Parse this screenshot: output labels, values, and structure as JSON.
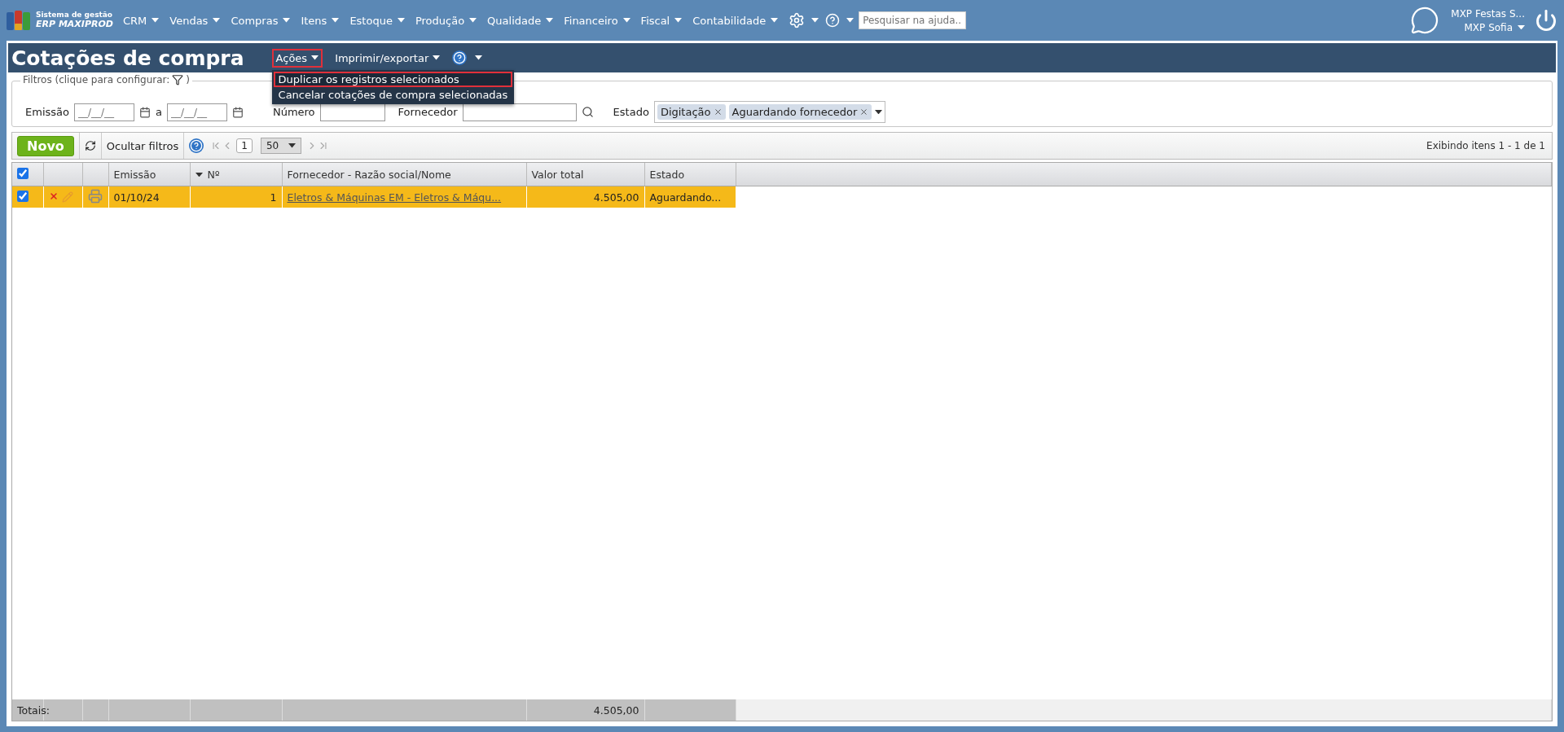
{
  "brand": {
    "line1": "Sistema de gestão",
    "line2": "ERP MAXIPROD"
  },
  "menu": [
    {
      "label": "CRM"
    },
    {
      "label": "Vendas"
    },
    {
      "label": "Compras"
    },
    {
      "label": "Itens"
    },
    {
      "label": "Estoque"
    },
    {
      "label": "Produção"
    },
    {
      "label": "Qualidade"
    },
    {
      "label": "Financeiro"
    },
    {
      "label": "Fiscal"
    },
    {
      "label": "Contabilidade"
    }
  ],
  "help_search": {
    "placeholder": "Pesquisar na ajuda..."
  },
  "user": {
    "company": "MXP Festas S...",
    "name": "MXP Sofia"
  },
  "page": {
    "title": "Cotações de compra"
  },
  "actions_menu": {
    "label": "Ações",
    "expanded": true,
    "items": [
      {
        "label": "Duplicar os registros selecionados",
        "selected": true
      },
      {
        "label": "Cancelar cotações de compra selecionadas",
        "selected": false
      }
    ]
  },
  "export_menu": {
    "label": "Imprimir/exportar"
  },
  "filters": {
    "legend": "Filtros (clique para configurar:",
    "legend_end": ")",
    "emissao_label": "Emissão",
    "date_placeholder": "__/__/__",
    "range_sep": "a",
    "numero_label": "Número",
    "fornecedor_label": "Fornecedor",
    "estado_label": "Estado",
    "estado_tags": [
      "Digitação",
      "Aguardando fornecedor"
    ]
  },
  "toolbar": {
    "new_button": "Novo",
    "hide_filters": "Ocultar filtros",
    "page": "1",
    "page_size": "50",
    "summary": "Exibindo itens 1 - 1 de 1"
  },
  "table": {
    "all_checked": true,
    "columns": [
      {
        "label": "Emissão",
        "sorted": false
      },
      {
        "label": "Nº",
        "sorted": true
      },
      {
        "label": "Fornecedor - Razão social/Nome",
        "sorted": false
      },
      {
        "label": "Valor total",
        "sorted": false
      },
      {
        "label": "Estado",
        "sorted": false
      }
    ],
    "rows": [
      {
        "selected": true,
        "emissao": "01/10/24",
        "numero": "1",
        "fornecedor": "Eletros & Máquinas EM - Eletros & Máqu...",
        "valor": "4.505,00",
        "estado": "Aguardando..."
      }
    ],
    "totals": {
      "label": "Totais:",
      "valor": "4.505,00"
    }
  }
}
